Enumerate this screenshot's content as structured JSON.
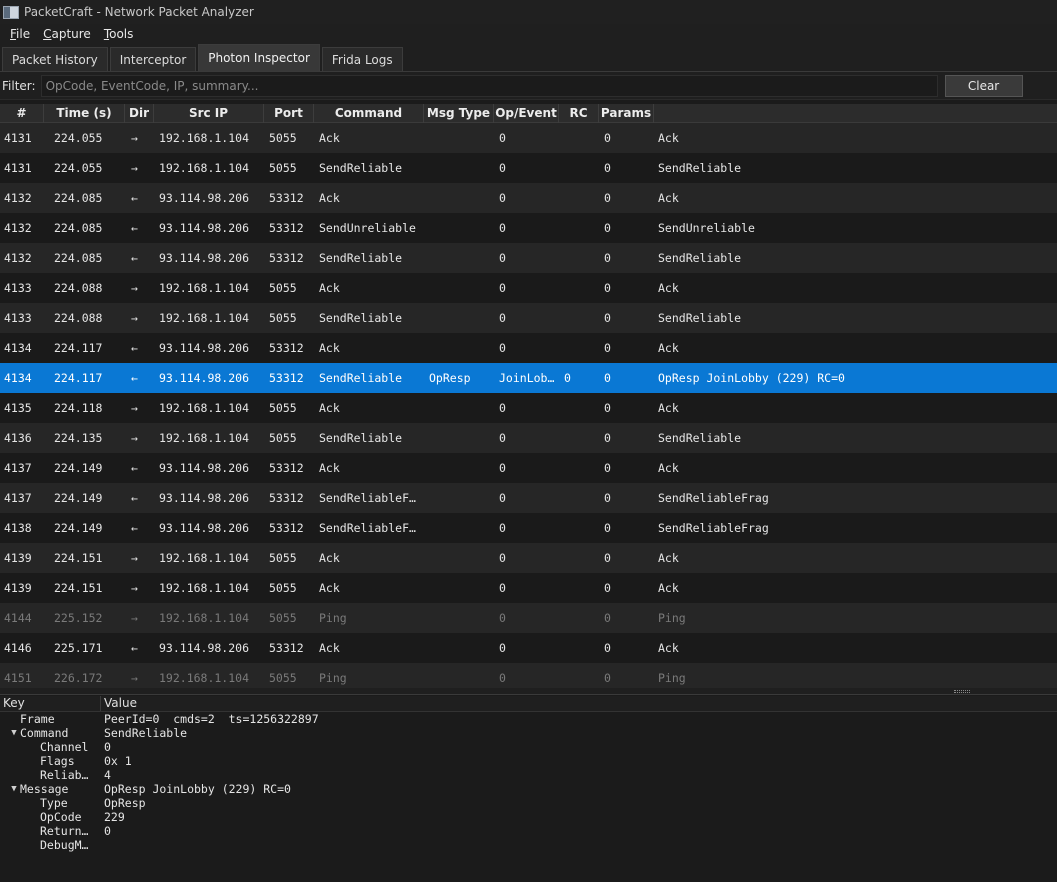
{
  "window": {
    "title": "PacketCraft - Network Packet Analyzer"
  },
  "menu": {
    "file": "File",
    "capture": "Capture",
    "tools": "Tools"
  },
  "tabs": [
    "Packet History",
    "Interceptor",
    "Photon Inspector",
    "Frida Logs"
  ],
  "active_tab": "Photon Inspector",
  "filter": {
    "label": "Filter:",
    "placeholder": "OpCode, EventCode, IP, summary...",
    "value": "",
    "clear_label": "Clear"
  },
  "table": {
    "columns": [
      "#",
      "Time (s)",
      "Dir",
      "Src IP",
      "Port",
      "Command",
      "Msg Type",
      "Op/Event",
      "RC",
      "Params"
    ],
    "rows": [
      {
        "num": "4131",
        "time": "224.055",
        "dir": "→",
        "src": "192.168.1.104",
        "port": "5055",
        "cmd": "Ack",
        "msg": "",
        "op": "0",
        "rc": "",
        "params": "0",
        "summary": "Ack"
      },
      {
        "num": "4131",
        "time": "224.055",
        "dir": "→",
        "src": "192.168.1.104",
        "port": "5055",
        "cmd": "SendReliable",
        "msg": "",
        "op": "0",
        "rc": "",
        "params": "0",
        "summary": "SendReliable"
      },
      {
        "num": "4132",
        "time": "224.085",
        "dir": "←",
        "src": "93.114.98.206",
        "port": "53312",
        "cmd": "Ack",
        "msg": "",
        "op": "0",
        "rc": "",
        "params": "0",
        "summary": "Ack"
      },
      {
        "num": "4132",
        "time": "224.085",
        "dir": "←",
        "src": "93.114.98.206",
        "port": "53312",
        "cmd": "SendUnreliable",
        "msg": "",
        "op": "0",
        "rc": "",
        "params": "0",
        "summary": "SendUnreliable"
      },
      {
        "num": "4132",
        "time": "224.085",
        "dir": "←",
        "src": "93.114.98.206",
        "port": "53312",
        "cmd": "SendReliable",
        "msg": "",
        "op": "0",
        "rc": "",
        "params": "0",
        "summary": "SendReliable"
      },
      {
        "num": "4133",
        "time": "224.088",
        "dir": "→",
        "src": "192.168.1.104",
        "port": "5055",
        "cmd": "Ack",
        "msg": "",
        "op": "0",
        "rc": "",
        "params": "0",
        "summary": "Ack"
      },
      {
        "num": "4133",
        "time": "224.088",
        "dir": "→",
        "src": "192.168.1.104",
        "port": "5055",
        "cmd": "SendReliable",
        "msg": "",
        "op": "0",
        "rc": "",
        "params": "0",
        "summary": "SendReliable"
      },
      {
        "num": "4134",
        "time": "224.117",
        "dir": "←",
        "src": "93.114.98.206",
        "port": "53312",
        "cmd": "Ack",
        "msg": "",
        "op": "0",
        "rc": "",
        "params": "0",
        "summary": "Ack"
      },
      {
        "num": "4134",
        "time": "224.117",
        "dir": "←",
        "src": "93.114.98.206",
        "port": "53312",
        "cmd": "SendReliable",
        "msg": "OpResp",
        "op": "JoinLob…",
        "rc": "0",
        "params": "0",
        "summary": "OpResp JoinLobby (229) RC=0",
        "selected": true
      },
      {
        "num": "4135",
        "time": "224.118",
        "dir": "→",
        "src": "192.168.1.104",
        "port": "5055",
        "cmd": "Ack",
        "msg": "",
        "op": "0",
        "rc": "",
        "params": "0",
        "summary": "Ack"
      },
      {
        "num": "4136",
        "time": "224.135",
        "dir": "→",
        "src": "192.168.1.104",
        "port": "5055",
        "cmd": "SendReliable",
        "msg": "",
        "op": "0",
        "rc": "",
        "params": "0",
        "summary": "SendReliable"
      },
      {
        "num": "4137",
        "time": "224.149",
        "dir": "←",
        "src": "93.114.98.206",
        "port": "53312",
        "cmd": "Ack",
        "msg": "",
        "op": "0",
        "rc": "",
        "params": "0",
        "summary": "Ack"
      },
      {
        "num": "4137",
        "time": "224.149",
        "dir": "←",
        "src": "93.114.98.206",
        "port": "53312",
        "cmd": "SendReliableF…",
        "msg": "",
        "op": "0",
        "rc": "",
        "params": "0",
        "summary": "SendReliableFrag"
      },
      {
        "num": "4138",
        "time": "224.149",
        "dir": "←",
        "src": "93.114.98.206",
        "port": "53312",
        "cmd": "SendReliableF…",
        "msg": "",
        "op": "0",
        "rc": "",
        "params": "0",
        "summary": "SendReliableFrag"
      },
      {
        "num": "4139",
        "time": "224.151",
        "dir": "→",
        "src": "192.168.1.104",
        "port": "5055",
        "cmd": "Ack",
        "msg": "",
        "op": "0",
        "rc": "",
        "params": "0",
        "summary": "Ack"
      },
      {
        "num": "4139",
        "time": "224.151",
        "dir": "→",
        "src": "192.168.1.104",
        "port": "5055",
        "cmd": "Ack",
        "msg": "",
        "op": "0",
        "rc": "",
        "params": "0",
        "summary": "Ack"
      },
      {
        "num": "4144",
        "time": "225.152",
        "dir": "→",
        "src": "192.168.1.104",
        "port": "5055",
        "cmd": "Ping",
        "msg": "",
        "op": "0",
        "rc": "",
        "params": "0",
        "summary": "Ping",
        "dim": true
      },
      {
        "num": "4146",
        "time": "225.171",
        "dir": "←",
        "src": "93.114.98.206",
        "port": "53312",
        "cmd": "Ack",
        "msg": "",
        "op": "0",
        "rc": "",
        "params": "0",
        "summary": "Ack"
      },
      {
        "num": "4151",
        "time": "226.172",
        "dir": "→",
        "src": "192.168.1.104",
        "port": "5055",
        "cmd": "Ping",
        "msg": "",
        "op": "0",
        "rc": "",
        "params": "0",
        "summary": "Ping",
        "dim": true
      }
    ]
  },
  "detail": {
    "columns": [
      "Key",
      "Value"
    ],
    "rows": [
      {
        "key": "Frame",
        "value": "PeerId=0  cmds=2  ts=1256322897",
        "level": 0,
        "expand": ""
      },
      {
        "key": "Command",
        "value": "SendReliable",
        "level": 0,
        "expand": "open"
      },
      {
        "key": "Channel",
        "value": "0",
        "level": 1,
        "expand": ""
      },
      {
        "key": "Flags",
        "value": "0x 1",
        "level": 1,
        "expand": ""
      },
      {
        "key": "Reliab…",
        "value": "4",
        "level": 1,
        "expand": ""
      },
      {
        "key": "Message",
        "value": "OpResp JoinLobby (229) RC=0",
        "level": 0,
        "expand": "open"
      },
      {
        "key": "Type",
        "value": "OpResp",
        "level": 1,
        "expand": ""
      },
      {
        "key": "OpCode",
        "value": "229",
        "level": 1,
        "expand": ""
      },
      {
        "key": "Return…",
        "value": "0",
        "level": 1,
        "expand": ""
      },
      {
        "key": "DebugM…",
        "value": "",
        "level": 1,
        "expand": ""
      }
    ]
  }
}
